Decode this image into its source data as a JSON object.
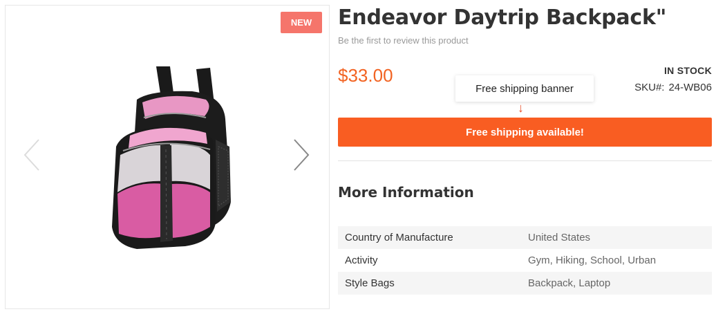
{
  "gallery": {
    "badge": "NEW",
    "prev_icon": "chevron-left-icon",
    "next_icon": "chevron-right-icon",
    "image": "pink-black-backpack"
  },
  "product": {
    "title": "Endeavor Daytrip Backpack\"",
    "review_link": "Be the first to review this product",
    "price": "$33.00",
    "stock": "IN STOCK",
    "sku_label": "SKU#:",
    "sku_value": "24-WB06"
  },
  "annotation": {
    "label": "Free shipping banner",
    "arrow": "↓"
  },
  "shipping_banner": {
    "text": "Free shipping available!"
  },
  "more_info": {
    "title": "More Information",
    "rows": [
      {
        "key": "Country of Manufacture",
        "value": "United States"
      },
      {
        "key": "Activity",
        "value": "Gym, Hiking, School, Urban"
      },
      {
        "key": "Style Bags",
        "value": "Backpack, Laptop"
      }
    ]
  },
  "colors": {
    "accent": "#f95d22",
    "price": "#f26322",
    "badge": "#f5756b"
  }
}
